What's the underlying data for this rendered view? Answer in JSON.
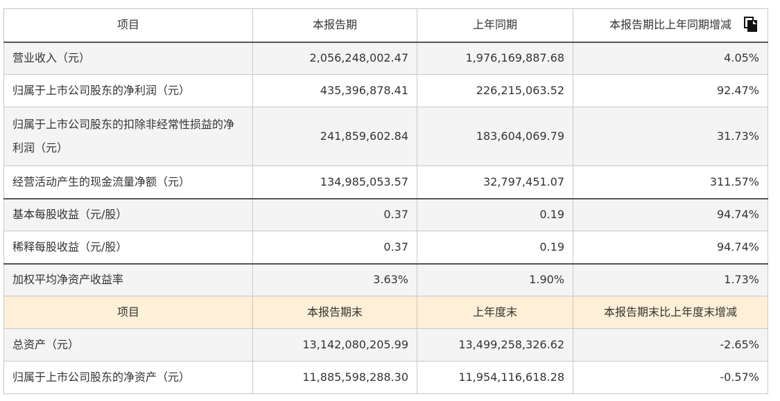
{
  "icons": {
    "copy": "copy-icon"
  },
  "header1": {
    "item": "项目",
    "current": "本报告期",
    "prior": "上年同期",
    "change": "本报告期比上年同期增减"
  },
  "rows1": [
    {
      "label": "营业收入（元）",
      "current": "2,056,248,002.47",
      "prior": "1,976,169,887.68",
      "change": "4.05%"
    },
    {
      "label": "归属于上市公司股东的净利润（元）",
      "current": "435,396,878.41",
      "prior": "226,215,063.52",
      "change": "92.47%"
    },
    {
      "label": "归属于上市公司股东的扣除非经常性损益的净利润（元）",
      "current": "241,859,602.84",
      "prior": "183,604,069.79",
      "change": "31.73%"
    },
    {
      "label": "经营活动产生的现金流量净额（元）",
      "current": "134,985,053.57",
      "prior": "32,797,451.07",
      "change": "311.57%"
    },
    {
      "label": "基本每股收益（元/股）",
      "current": "0.37",
      "prior": "0.19",
      "change": "94.74%"
    },
    {
      "label": "稀释每股收益（元/股）",
      "current": "0.37",
      "prior": "0.19",
      "change": "94.74%"
    },
    {
      "label": "加权平均净资产收益率",
      "current": "3.63%",
      "prior": "1.90%",
      "change": "1.73%"
    }
  ],
  "header2": {
    "item": "项目",
    "current": "本报告期末",
    "prior": "上年度末",
    "change": "本报告期末比上年度末增减"
  },
  "rows2": [
    {
      "label": "总资产（元）",
      "current": "13,142,080,205.99",
      "prior": "13,499,258,326.62",
      "change": "-2.65%"
    },
    {
      "label": "归属于上市公司股东的净资产（元）",
      "current": "11,885,598,288.30",
      "prior": "11,954,116,618.28",
      "change": "-0.57%"
    }
  ]
}
